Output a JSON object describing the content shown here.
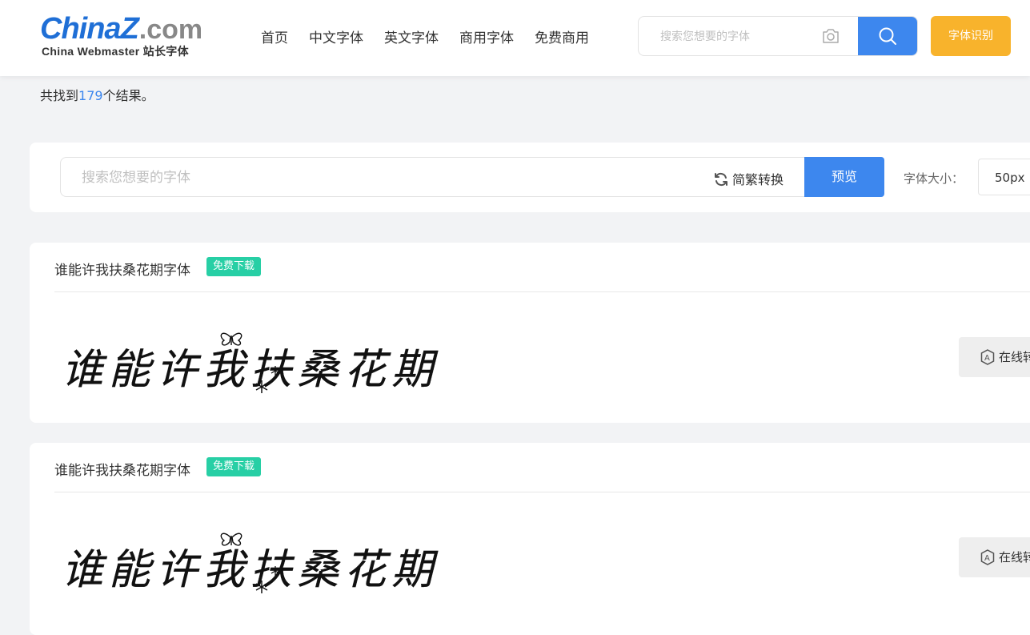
{
  "header": {
    "logo": {
      "main_china": "China",
      "main_z": "Z",
      "main_com": ".com",
      "subtitle": "China Webmaster 站长字体"
    },
    "nav": [
      "首页",
      "中文字体",
      "英文字体",
      "商用字体",
      "免费商用"
    ],
    "search": {
      "placeholder": "搜索您想要的字体"
    },
    "recognize_label": "字体识别"
  },
  "results": {
    "prefix": "共找到",
    "count": "179",
    "suffix": "个结果。"
  },
  "preview_bar": {
    "placeholder": "搜索您想要的字体",
    "convert_label": "简繁转换",
    "preview_label": "预览",
    "size_label": "字体大小：",
    "size_value": "50px"
  },
  "fonts": [
    {
      "name": "谁能许我扶桑花期字体",
      "badge": "免费下载",
      "preview_text": "谁能许我扶桑花期",
      "online_label": "在线转"
    },
    {
      "name": "谁能许我扶桑花期字体",
      "badge": "免费下载",
      "preview_text": "谁能许我扶桑花期",
      "online_label": "在线转"
    }
  ],
  "colors": {
    "accent": "#3d87ee",
    "badge": "#27cfa5",
    "recognize": "#f8b32c"
  },
  "icons": [
    "camera-icon",
    "search-icon",
    "refresh-icon",
    "online-edit-icon",
    "butterfly-icon",
    "snowflake-icon"
  ]
}
